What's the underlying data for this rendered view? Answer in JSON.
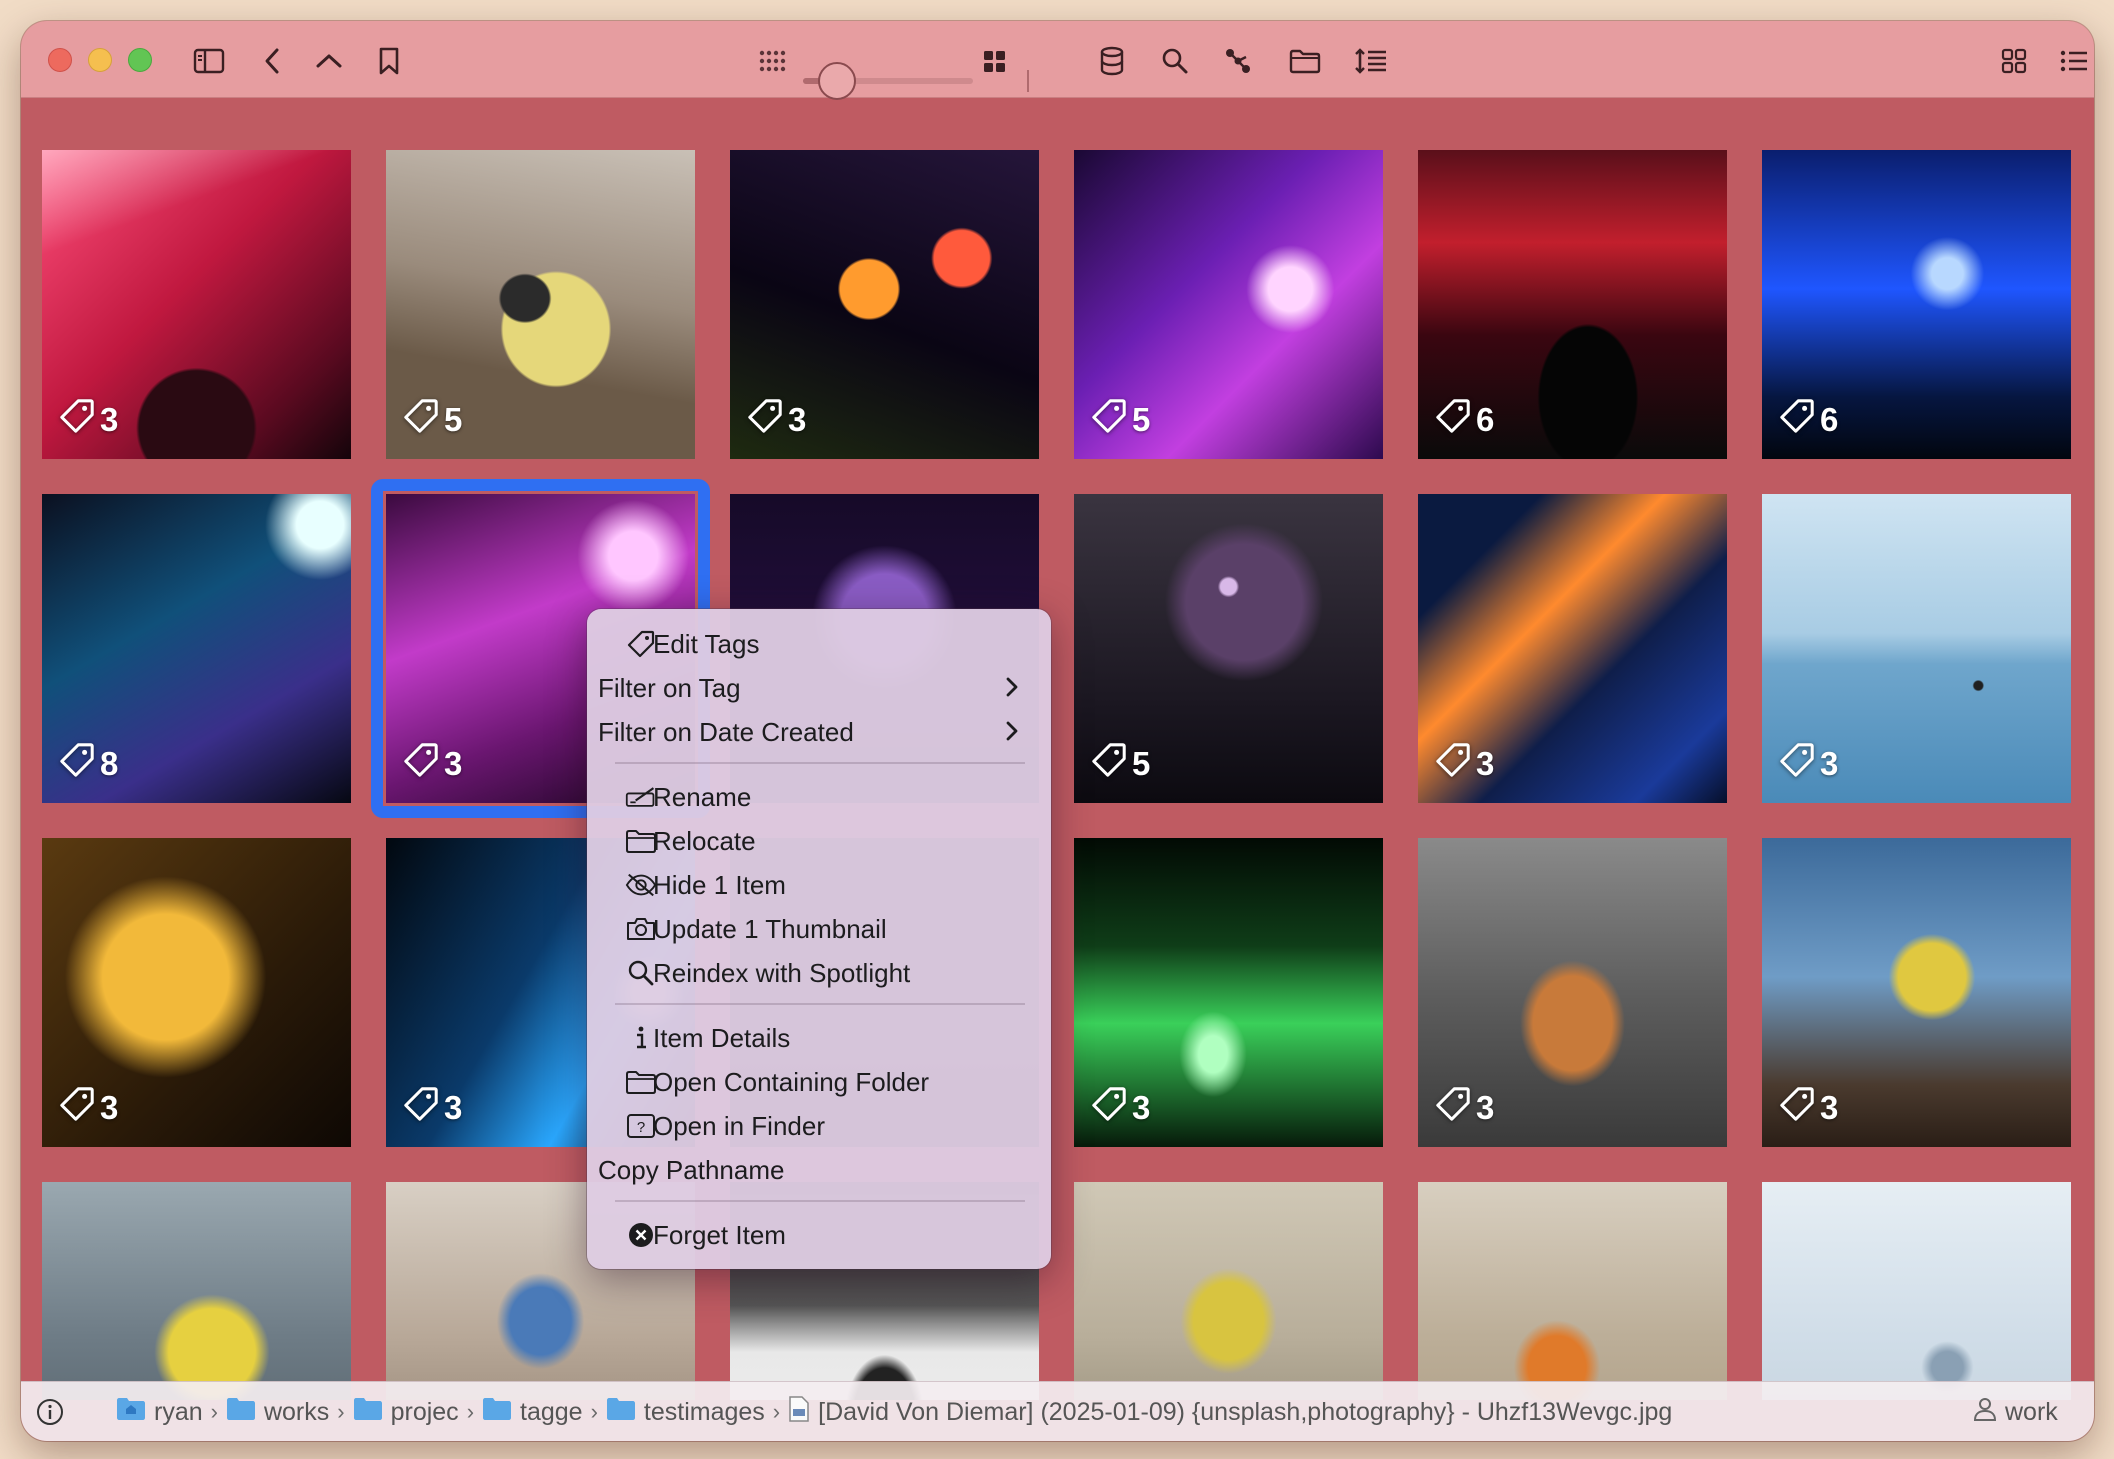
{
  "toolbar": {
    "icons": [
      "sidebar-icon",
      "back-icon",
      "up-icon",
      "bookmark-icon",
      "small-grid-icon",
      "size-slider",
      "large-grid-icon",
      "database-icon",
      "search-icon",
      "graph-icon",
      "folder-icon",
      "sort-icon",
      "grid-view-icon",
      "list-view-icon"
    ],
    "thumbnail_size_level": 0.2
  },
  "thumbnails": [
    {
      "tags": "3",
      "subject": "concert lasers"
    },
    {
      "tags": "5",
      "subject": "great tit bird"
    },
    {
      "tags": "3",
      "subject": "neon signs"
    },
    {
      "tags": "5",
      "subject": "DJ at booth"
    },
    {
      "tags": "6",
      "subject": "stage lights DJ"
    },
    {
      "tags": "6",
      "subject": "blue lasers crowd"
    },
    {
      "tags": "8",
      "subject": "stage light beams"
    },
    {
      "tags": "3",
      "subject": "pink lasers stage"
    },
    {
      "tags": "",
      "subject": "purple globe"
    },
    {
      "tags": "5",
      "subject": "foggy ring light"
    },
    {
      "tags": "3",
      "subject": "city at night aerial"
    },
    {
      "tags": "3",
      "subject": "paddleboarder at sea"
    },
    {
      "tags": "3",
      "subject": "yellow leaves"
    },
    {
      "tags": "3",
      "subject": "blue light rays"
    },
    {
      "tags": "",
      "subject": "hidden"
    },
    {
      "tags": "3",
      "subject": "green laser beams"
    },
    {
      "tags": "3",
      "subject": "chow chow dog"
    },
    {
      "tags": "3",
      "subject": "great tit on log"
    },
    {
      "tags": "",
      "subject": "blue tit"
    },
    {
      "tags": "",
      "subject": "blue tit on branch"
    },
    {
      "tags": "",
      "subject": "jackdaw in snow"
    },
    {
      "tags": "",
      "subject": "blue tit"
    },
    {
      "tags": "",
      "subject": "mandarin duck"
    },
    {
      "tags": "",
      "subject": "blue tit in tree"
    }
  ],
  "context_menu": {
    "edit_tags": "Edit Tags",
    "filter_on_tag": "Filter on Tag",
    "filter_on_date": "Filter on Date Created",
    "rename": "Rename",
    "relocate": "Relocate",
    "hide": "Hide 1 Item",
    "update_thumbnail": "Update 1 Thumbnail",
    "reindex": "Reindex with Spotlight",
    "item_details": "Item Details",
    "open_folder": "Open Containing Folder",
    "open_finder": "Open in Finder",
    "copy_pathname": "Copy Pathname",
    "forget": "Forget Item"
  },
  "pathbar": {
    "crumbs": [
      "ryan",
      "works",
      "projec",
      "tagge",
      "testimages"
    ],
    "filename": "[David Von Diemar] (2025-01-09) {unsplash,photography} - Uhzf13Wevgc.jpg",
    "workspace": "work"
  }
}
